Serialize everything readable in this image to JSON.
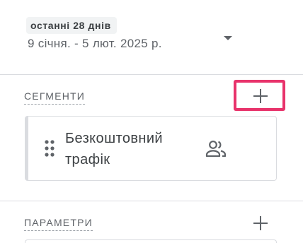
{
  "date_range": {
    "preset_label": "останні 28 днів",
    "range_text": "9 січня. - 5 лют. 2025 р.",
    "dropdown_icon": "arrow-drop-down-icon"
  },
  "segments_section": {
    "title": "СЕГМЕНТИ",
    "add_icon": "plus-icon",
    "highlight_color": "#e8336b",
    "items": [
      {
        "label": "Безкоштовний трафік",
        "handle_icon": "drag-handle-icon",
        "type_icon": "people-icon"
      }
    ]
  },
  "parameters_section": {
    "title": "ПАРАМЕТРИ",
    "add_icon": "plus-icon"
  },
  "colors": {
    "divider": "#dadce0",
    "text_secondary": "#5f6368",
    "chip_bg": "#f1f3f4"
  }
}
